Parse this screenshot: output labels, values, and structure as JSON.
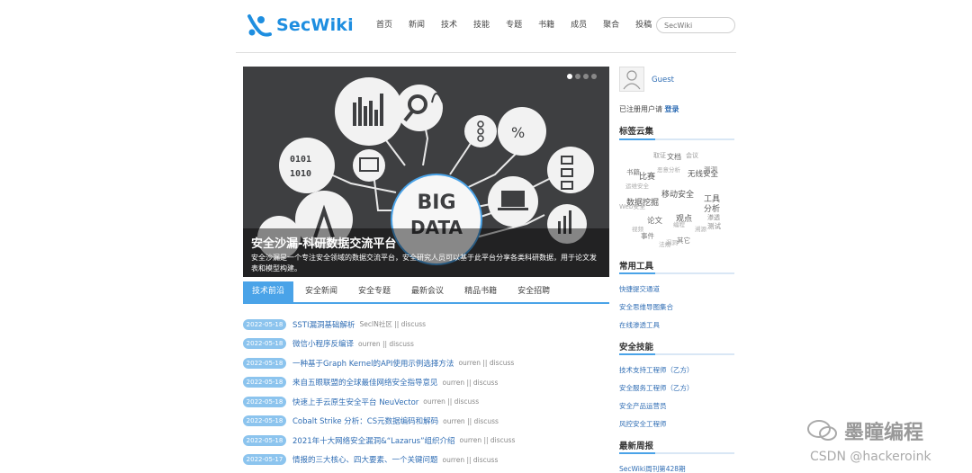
{
  "header": {
    "logo_text": "SecWiki",
    "nav": [
      "首页",
      "新闻",
      "技术",
      "技能",
      "专题",
      "书籍",
      "成员",
      "聚合",
      "投稿"
    ],
    "search_placeholder": "SecWiki"
  },
  "banner": {
    "title": "安全沙漏-科研数据交流平台",
    "text": "安全沙漏是一个专注安全领域的数据交流平台，安全研究人员可以基于此平台分享各类科研数据，用于论文发表和模型构建。",
    "image_text": "BIG DATA",
    "binary_text": [
      "0101",
      "1010"
    ]
  },
  "tabs": [
    "技术前沿",
    "安全新闻",
    "安全专题",
    "最新会议",
    "精品书籍",
    "安全招聘"
  ],
  "news": [
    {
      "date": "2022-05-18",
      "title": "SSTI漏洞基础解析",
      "source": "SecIN社区 || discuss"
    },
    {
      "date": "2022-05-18",
      "title": "微信小程序反编译",
      "source": "ourren || discuss"
    },
    {
      "date": "2022-05-18",
      "title": "一种基于Graph Kernel的API使用示例选择方法",
      "source": "ourren || discuss"
    },
    {
      "date": "2022-05-18",
      "title": "来自五眼联盟的全球最佳网络安全指导意见",
      "source": "ourren || discuss"
    },
    {
      "date": "2022-05-18",
      "title": "快速上手云原生安全平台 NeuVector",
      "source": "ourren || discuss"
    },
    {
      "date": "2022-05-18",
      "title": "Cobalt Strike 分析：CS元数据编码和解码",
      "source": "ourren || discuss"
    },
    {
      "date": "2022-05-18",
      "title": "2021年十大网络安全漏洞&“Lazarus”组织介绍",
      "source": "ourren || discuss"
    },
    {
      "date": "2022-05-17",
      "title": "情报的三大核心、四大要素、一个关键问题",
      "source": "ourren || discuss"
    }
  ],
  "sidebar": {
    "guest": "Guest",
    "login_prefix": "已注册用户请",
    "login_link": "登录",
    "tag_cloud_title": "标签云集",
    "tags": [
      "取证",
      "文档",
      "会议",
      "恶意分析",
      "书籍",
      "比赛",
      "无线安全",
      "漏洞",
      "运维安全",
      "数据挖掘",
      "移动安全",
      "工具",
      "Web安全",
      "论文",
      "观点",
      "分析",
      "视频",
      "事件",
      "漏洞",
      "其它",
      "法规",
      "编程",
      "测试",
      "溯源",
      "渗透"
    ],
    "tools_title": "常用工具",
    "tools": [
      "快捷提交通道",
      "安全思维导图集合",
      "在线渗透工具"
    ],
    "jobs_title": "安全技能",
    "jobs": [
      "技术支持工程师（乙方）",
      "安全服务工程师（乙方）",
      "安全产品运营员",
      "风控安全工程师"
    ],
    "weekly_title": "最新周报",
    "weekly": [
      "SecWiki周刊第428期"
    ]
  },
  "watermark": {
    "brand": "墨瞳编程",
    "csdn": "CSDN @hackeroink"
  },
  "colors": {
    "accent": "#4aa3e8",
    "link": "#2f6db4",
    "logo": "#1e8ee0"
  }
}
